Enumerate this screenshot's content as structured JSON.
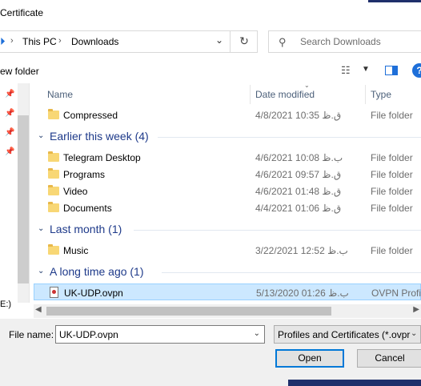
{
  "window": {
    "title": "Certificate"
  },
  "address": {
    "crumbs": [
      "This PC",
      "Downloads"
    ]
  },
  "search": {
    "placeholder": "Search Downloads"
  },
  "toolbar": {
    "new_folder": "ew folder"
  },
  "nav": {
    "drive_label": "E:)"
  },
  "columns": {
    "name": "Name",
    "date": "Date modified",
    "type": "Type"
  },
  "groups": {
    "earlier": "Earlier this week (4)",
    "lastmonth": "Last month (1)",
    "longago": "A long time ago (1)"
  },
  "files": [
    {
      "name": "Compressed",
      "date": "4/8/2021 10:35 ق.ظ",
      "type": "File folder"
    },
    {
      "name": "Telegram Desktop",
      "date": "4/6/2021 10:08 ب.ظ",
      "type": "File folder"
    },
    {
      "name": "Programs",
      "date": "4/6/2021 09:57 ق.ظ",
      "type": "File folder"
    },
    {
      "name": "Video",
      "date": "4/6/2021 01:48 ق.ظ",
      "type": "File folder"
    },
    {
      "name": "Documents",
      "date": "4/4/2021 01:06 ق.ظ",
      "type": "File folder"
    },
    {
      "name": "Music",
      "date": "3/22/2021 12:52 ب.ظ",
      "type": "File folder"
    },
    {
      "name": "UK-UDP.ovpn",
      "date": "5/13/2020 01:26 ب.ظ",
      "type": "OVPN Profil"
    }
  ],
  "footer": {
    "file_name_label": "File name:",
    "file_name_value": "UK-UDP.ovpn",
    "filter": "Profiles and Certificates (*.ovpr",
    "open": "Open",
    "cancel": "Cancel"
  },
  "colors": {
    "accent": "#0078d7",
    "selection": "#cce8ff",
    "group_text": "#1e3a8a"
  }
}
